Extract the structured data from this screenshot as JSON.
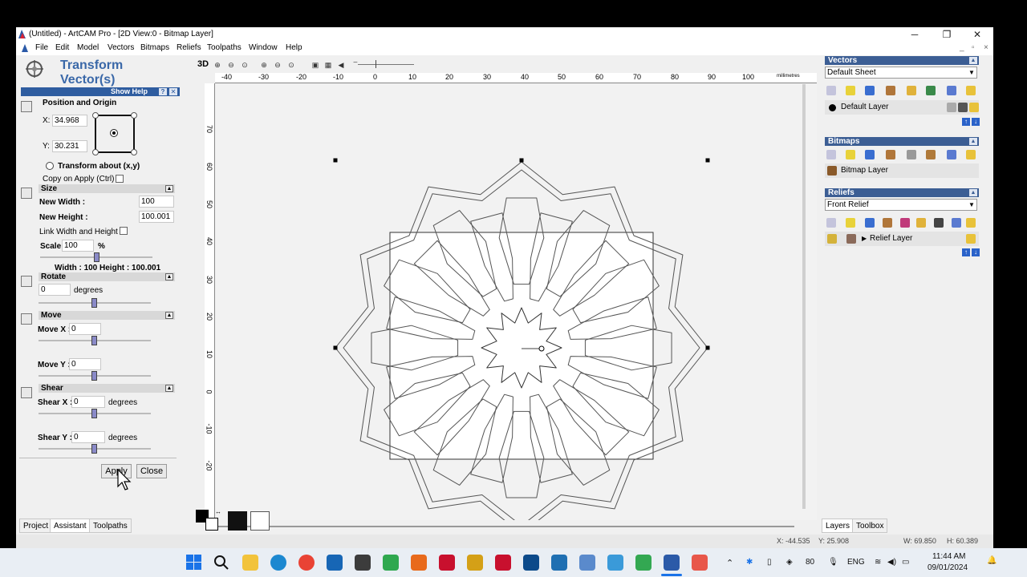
{
  "window": {
    "title": "(Untitled) - ArtCAM Pro - [2D View:0 - Bitmap Layer]",
    "min_glyph": "─",
    "max_glyph": "❐",
    "close_glyph": "✕"
  },
  "menu": [
    "File",
    "Edit",
    "Model",
    "Vectors",
    "Bitmaps",
    "Reliefs",
    "Toolpaths",
    "Window",
    "Help"
  ],
  "mdi_controls": [
    "_",
    "▫",
    "×"
  ],
  "left_panel": {
    "title": "Transform Vector(s)",
    "show_help": "Show Help",
    "position_origin": {
      "heading": "Position and Origin",
      "x_label": "X:",
      "x_value": "34.968",
      "y_label": "Y:",
      "y_value": "30.231",
      "transform_about": "Transform about (x,y)",
      "copy_on_apply": "Copy on Apply (Ctrl)"
    },
    "size": {
      "heading": "Size",
      "width_label": "New Width :",
      "width_value": "100",
      "height_label": "New Height :",
      "height_value": "100.001",
      "link_label": "Link Width and Height",
      "scale_label": "Scale",
      "scale_value": "100",
      "scale_unit": "%",
      "summary": "Width :  100  Height :  100.001"
    },
    "rotate": {
      "heading": "Rotate",
      "value": "0",
      "unit": "degrees"
    },
    "move": {
      "heading": "Move",
      "x_label": "Move X :",
      "x_value": "0",
      "y_label": "Move Y :",
      "y_value": "0"
    },
    "shear": {
      "heading": "Shear",
      "x_label": "Shear X :",
      "x_value": "0",
      "y_label": "Shear Y :",
      "y_value": "0",
      "unit": "degrees"
    },
    "apply_label": "Apply",
    "close_label": "Close",
    "tabs": [
      "Project",
      "Assistant",
      "Toolpaths"
    ]
  },
  "view_toolbar": {
    "mode_label": "3D"
  },
  "ruler": {
    "top_ticks": [
      "-40",
      "-30",
      "-20",
      "-10",
      "0",
      "10",
      "20",
      "30",
      "40",
      "50",
      "60",
      "70",
      "80",
      "90",
      "100"
    ],
    "units": "millimetres",
    "left_ticks": [
      "70",
      "60",
      "50",
      "40",
      "30",
      "20",
      "10",
      "0",
      "-10",
      "-20"
    ]
  },
  "right_panel": {
    "vectors": {
      "heading": "Vectors",
      "sheet": "Default Sheet",
      "layer": "Default Layer"
    },
    "bitmaps": {
      "heading": "Bitmaps",
      "layer": "Bitmap Layer"
    },
    "reliefs": {
      "heading": "Reliefs",
      "relief": "Front Relief",
      "layer": "Relief Layer"
    },
    "tabs": [
      "Layers",
      "Toolbox"
    ]
  },
  "status": {
    "x": "X: -44.535",
    "y": "Y: 25.908",
    "w": "W: 69.850",
    "h": "H: 60.389"
  },
  "taskbar": {
    "lang": "ENG",
    "badge": "80",
    "time": "11:44 AM",
    "date": "09/01/2024",
    "colors": {
      "windows": "#1a73e8",
      "accent": "#3c5e94"
    }
  }
}
